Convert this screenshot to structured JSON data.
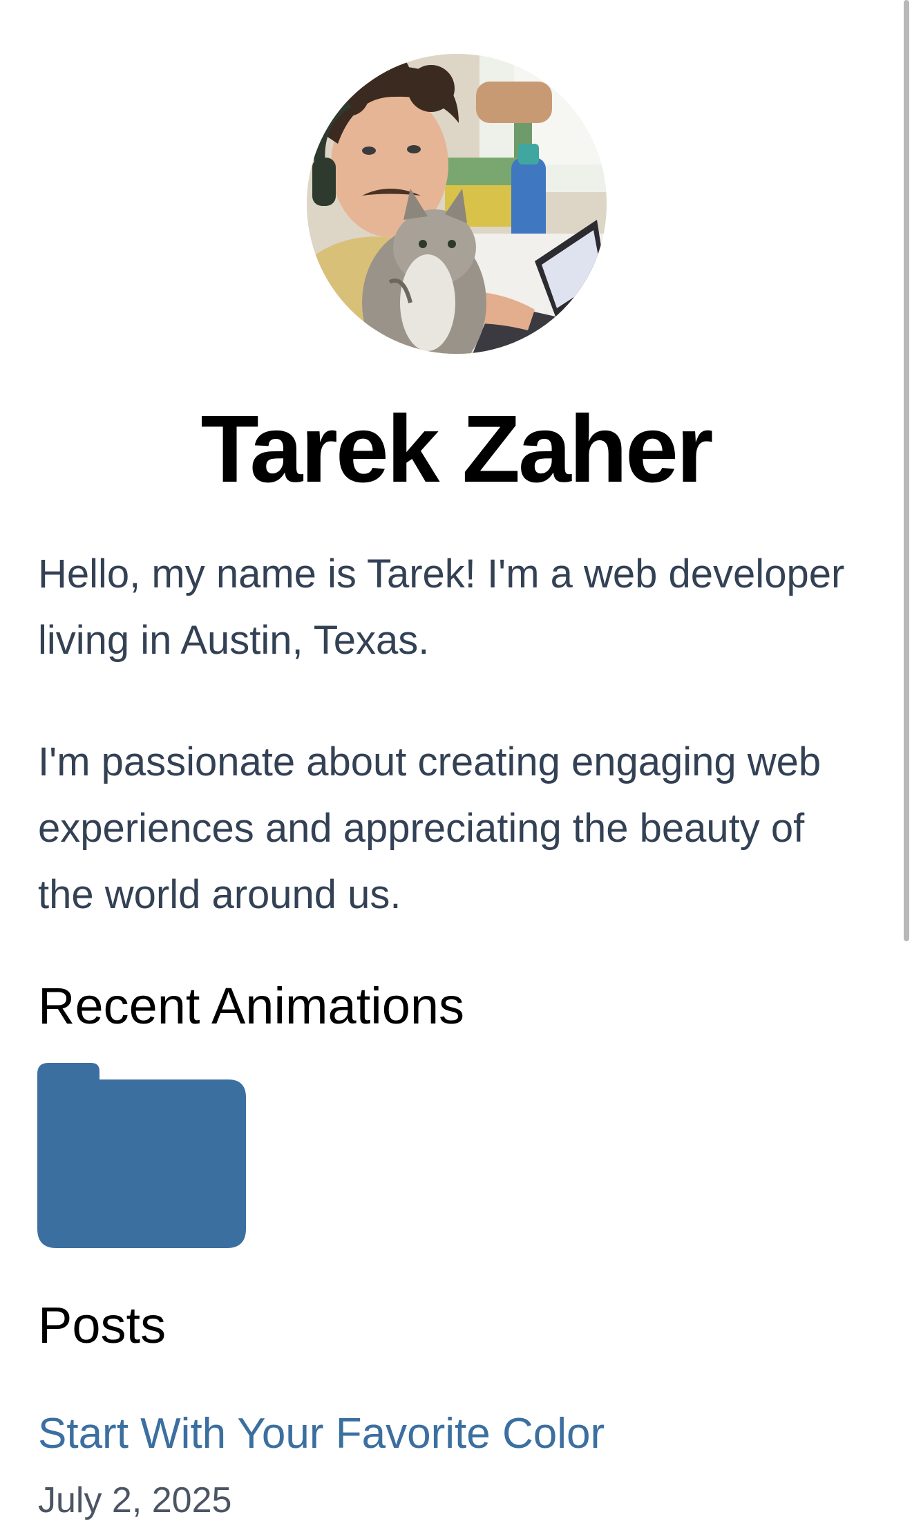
{
  "profile": {
    "avatar_alt": "Profile photo",
    "name": "Tarek Zaher"
  },
  "bio": {
    "paragraph_1": "Hello, my name is Tarek! I'm a web developer living in Austin, Texas.",
    "paragraph_2": "I'm passionate about creating engaging web experiences and appreciating the beauty of the world around us."
  },
  "animations": {
    "heading": "Recent Animations",
    "items": [
      {
        "icon": "folder-icon",
        "color": "#3b6fa0"
      }
    ]
  },
  "posts": {
    "heading": "Posts",
    "items": [
      {
        "title": "Start With Your Favorite Color",
        "date": "July 2, 2025"
      }
    ]
  },
  "colors": {
    "link": "#3b6fa0",
    "body_text": "#334155",
    "heading": "#000000"
  }
}
